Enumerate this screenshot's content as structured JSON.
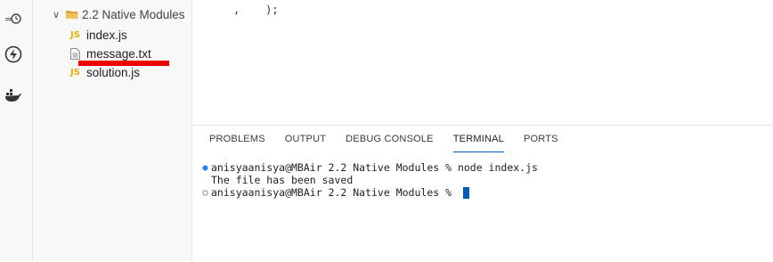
{
  "explorer": {
    "folder_name": "2.2 Native Modules",
    "files": [
      {
        "name": "index.js",
        "type": "js"
      },
      {
        "name": "message.txt",
        "type": "txt"
      },
      {
        "name": "solution.js",
        "type": "js"
      }
    ]
  },
  "activity_bar": {
    "icons": [
      "remote-explorer-icon",
      "lightning-icon",
      "docker-icon"
    ]
  },
  "editor": {
    "code_fragment": ",    );"
  },
  "panel": {
    "tabs": [
      {
        "label": "PROBLEMS",
        "active": false
      },
      {
        "label": "OUTPUT",
        "active": false
      },
      {
        "label": "DEBUG CONSOLE",
        "active": false
      },
      {
        "label": "TERMINAL",
        "active": true
      },
      {
        "label": "PORTS",
        "active": false
      }
    ],
    "terminal": {
      "lines": [
        {
          "marker": "filled",
          "text": "anisyaanisya@MBAir 2.2 Native Modules % node index.js"
        },
        {
          "marker": "none",
          "text": "The file has been saved"
        },
        {
          "marker": "hollow",
          "text": "anisyaanisya@MBAir 2.2 Native Modules % "
        }
      ]
    }
  },
  "colors": {
    "accent": "#005fb8",
    "js_badge": "#e4b000",
    "annotation_underline": "#ee0000"
  }
}
